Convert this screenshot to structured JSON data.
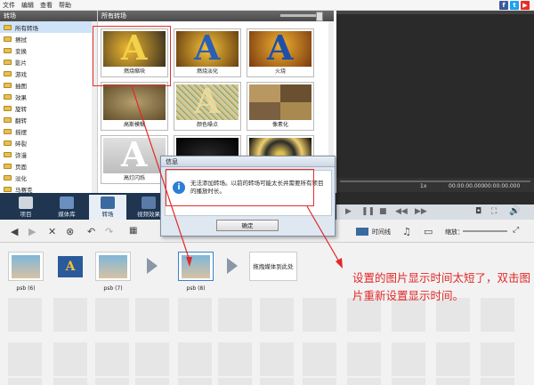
{
  "menu": [
    "文件",
    "编辑",
    "查看",
    "帮助"
  ],
  "social": [
    {
      "icon": "facebook-icon",
      "glyph": "f",
      "color": "#3b5998"
    },
    {
      "icon": "twitter-icon",
      "glyph": "t",
      "color": "#1da1f2"
    },
    {
      "icon": "youtube-icon",
      "glyph": "▶",
      "color": "#e52d27"
    }
  ],
  "tree": {
    "header": "转场",
    "items": [
      "所有转场",
      "擦拭",
      "变换",
      "影片",
      "游戏",
      "抽图",
      "效果",
      "旋转",
      "翻转",
      "摇摆",
      "碎裂",
      "弥漫",
      "页面",
      "淡化",
      "马赛克"
    ]
  },
  "gallery": {
    "header": "所有转场",
    "items": [
      "燃烧缩块",
      "燃烧淡化",
      "火烧",
      "高斯模糊",
      "颜色噪点",
      "像素化",
      "高灯闪烁",
      "",
      ""
    ]
  },
  "tabs": [
    "项目",
    "媒体库",
    "转场",
    "视频效果"
  ],
  "preview": {
    "speed": "1x",
    "time_current": "00:00:00.000",
    "time_total": "00:00:00.000"
  },
  "toolbar": {
    "timeline": "时间线",
    "zoom": "缩放："
  },
  "story": {
    "items": [
      {
        "label": "psb (6)"
      },
      {
        "label": "psb (7)"
      },
      {
        "label": "psb (8)"
      }
    ],
    "drop_hint": "拖拽媒体到此处"
  },
  "dialog": {
    "title": "信息",
    "message": "无法添加转场。以前的转场可能太长并需要所有项目的播放时长。",
    "ok": "确定"
  },
  "annotation": "设置的图片显示时间太短了，双击图片重新设置显示时间。",
  "colors": {
    "dark_panel": "#1f3550",
    "annotation_red": "#e22828"
  }
}
